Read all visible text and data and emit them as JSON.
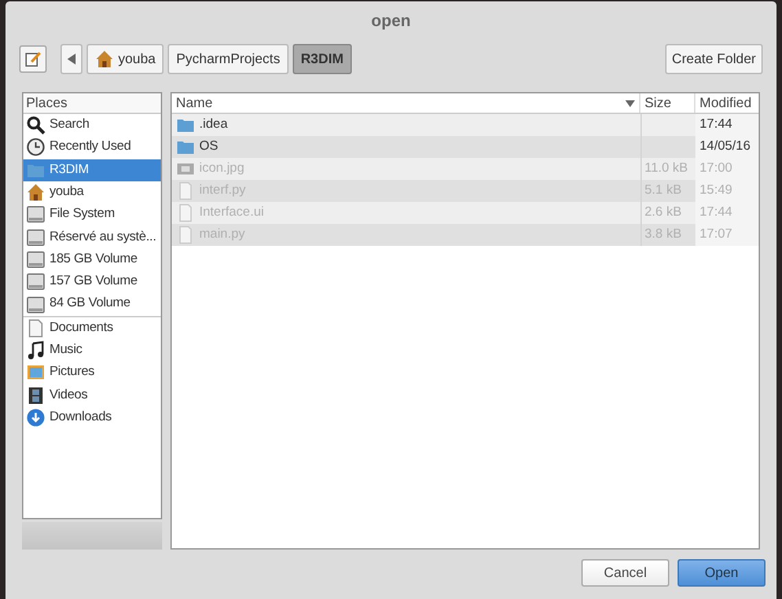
{
  "window": {
    "title": "open"
  },
  "path_bar": [
    {
      "label": "youba",
      "kind": "home",
      "selected": false
    },
    {
      "label": "PycharmProjects",
      "kind": "folder",
      "selected": false
    },
    {
      "label": "R3DIM",
      "kind": "folder",
      "selected": true
    }
  ],
  "create_folder": "Create Folder",
  "places": {
    "header": "Places",
    "groups": [
      [
        {
          "label": "Search",
          "kind": "search",
          "selected": false
        },
        {
          "label": "Recently Used",
          "kind": "recent",
          "selected": false
        },
        {
          "label": "R3DIM",
          "kind": "folder",
          "selected": true
        },
        {
          "label": "youba",
          "kind": "home",
          "selected": false
        },
        {
          "label": "File System",
          "kind": "drive",
          "selected": false
        },
        {
          "label": "Réservé au systè...",
          "kind": "drive",
          "selected": false
        },
        {
          "label": "185 GB Volume",
          "kind": "drive",
          "selected": false
        },
        {
          "label": "157 GB Volume",
          "kind": "drive",
          "selected": false
        },
        {
          "label": "84 GB Volume",
          "kind": "drive",
          "selected": false
        }
      ],
      [
        {
          "label": "Documents",
          "kind": "document",
          "selected": false
        },
        {
          "label": "Music",
          "kind": "music",
          "selected": false
        },
        {
          "label": "Pictures",
          "kind": "pictures",
          "selected": false
        },
        {
          "label": "Videos",
          "kind": "videos",
          "selected": false
        },
        {
          "label": "Downloads",
          "kind": "downloads",
          "selected": false
        }
      ]
    ]
  },
  "files": {
    "columns": [
      "Name",
      "Size",
      "Modified"
    ],
    "rows": [
      {
        "name": ".idea",
        "size": "",
        "modified": "17:44",
        "kind": "folder",
        "disabled": false
      },
      {
        "name": "OS",
        "size": "",
        "modified": "14/05/16",
        "kind": "folder",
        "disabled": false
      },
      {
        "name": "icon.jpg",
        "size": "11.0 kB",
        "modified": "17:00",
        "kind": "image",
        "disabled": true
      },
      {
        "name": "interf.py",
        "size": "5.1 kB",
        "modified": "15:49",
        "kind": "file",
        "disabled": true
      },
      {
        "name": "Interface.ui",
        "size": "2.6 kB",
        "modified": "17:44",
        "kind": "file",
        "disabled": true
      },
      {
        "name": "main.py",
        "size": "3.8 kB",
        "modified": "17:07",
        "kind": "file",
        "disabled": true
      }
    ]
  },
  "buttons": [
    {
      "label": "Cancel",
      "kind": "secondary"
    },
    {
      "label": "Open",
      "kind": "primary"
    }
  ]
}
